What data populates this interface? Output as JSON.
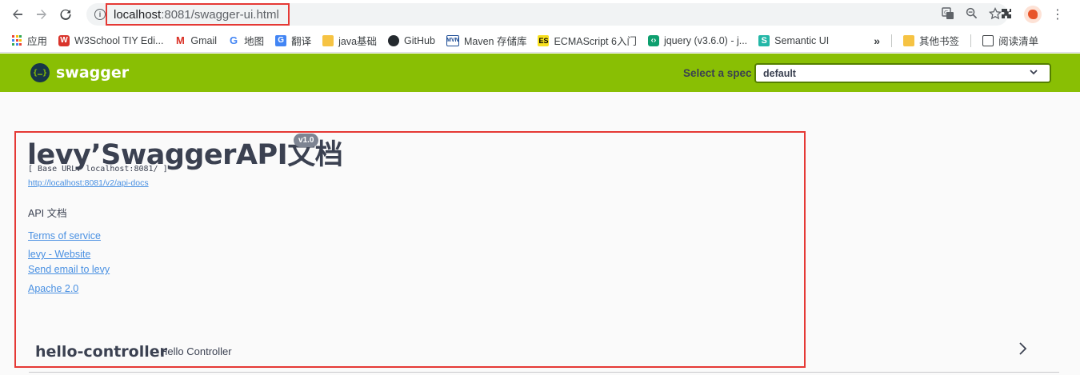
{
  "browser": {
    "url_host": "localhost",
    "url_rest": ":8081/swagger-ui.html"
  },
  "bookmarks": [
    {
      "label": "应用",
      "icon": "apps-grid-icon"
    },
    {
      "label": "W3School TIY Edi...",
      "icon": "w3school-icon"
    },
    {
      "label": "Gmail",
      "icon": "gmail-icon"
    },
    {
      "label": "地图",
      "icon": "google-maps-icon"
    },
    {
      "label": "翻译",
      "icon": "translate-icon"
    },
    {
      "label": "java基础",
      "icon": "folder-icon"
    },
    {
      "label": "GitHub",
      "icon": "github-icon"
    },
    {
      "label": "Maven 存储库",
      "icon": "maven-icon"
    },
    {
      "label": "ECMAScript 6入门",
      "icon": "es-icon"
    },
    {
      "label": "jquery (v3.6.0) - j...",
      "icon": "jquery-icon"
    },
    {
      "label": "Semantic UI",
      "icon": "semantic-ui-icon"
    }
  ],
  "bookmarks_more": "»",
  "other_bookmarks": "其他书签",
  "reading_list": "阅读清单",
  "swagger": {
    "logo_text": "swagger",
    "logo_mark": "{…}",
    "spec_label": "Select a spec",
    "spec_value": "default"
  },
  "info": {
    "title": "levy’SwaggerAPI文档",
    "version": "v1.0",
    "base_url": "[ Base URL: localhost:8081/ ]",
    "docs_link": "http://localhost:8081/v2/api-docs",
    "description": "API 文档",
    "terms": "Terms of service",
    "website": "levy - Website",
    "email": "Send email to levy",
    "license": "Apache 2.0"
  },
  "controllers": [
    {
      "name": "hello-controller",
      "description": "Hello Controller"
    }
  ],
  "colors": {
    "swagger_green": "#89bf04",
    "highlight_red": "#e53935",
    "link_blue": "#4990e2",
    "text_dark": "#3b4151"
  }
}
